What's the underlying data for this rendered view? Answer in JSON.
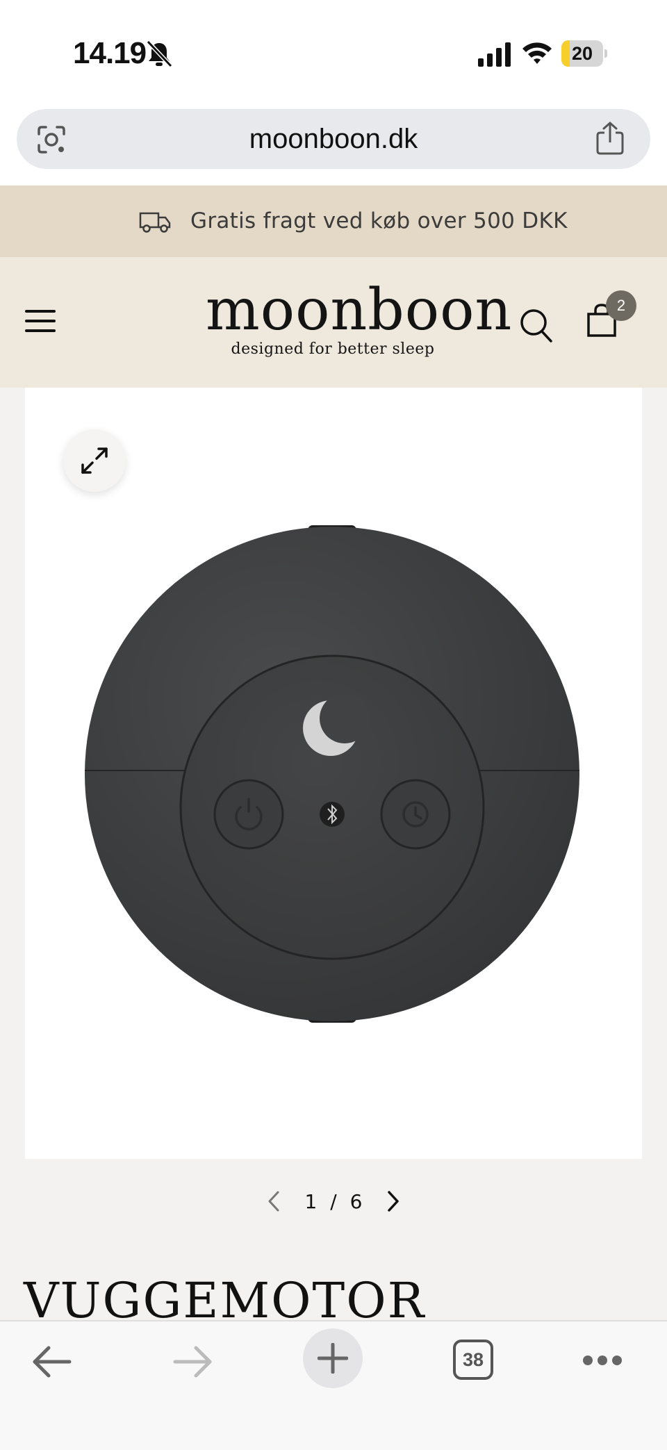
{
  "status_bar": {
    "time": "14.19",
    "battery": "20",
    "battery_level": 0.2
  },
  "browser": {
    "url": "moonboon.dk",
    "tab_count": "38"
  },
  "promo": {
    "text": "Gratis fragt ved køb over 500 DKK"
  },
  "header": {
    "logo": "moonboon",
    "tagline": "designed for better sleep",
    "cart_count": "2"
  },
  "gallery": {
    "current": "1",
    "separator": "/",
    "total": "6"
  },
  "product": {
    "title": "VUGGEMOTOR"
  },
  "icons": {
    "status": [
      "bell-off-icon",
      "signal-icon",
      "wifi-icon",
      "battery-icon"
    ],
    "browser": [
      "lens-icon",
      "share-icon",
      "back-arrow-icon",
      "forward-arrow-icon",
      "plus-icon",
      "more-icon"
    ],
    "site": [
      "truck-icon",
      "menu-icon",
      "search-icon",
      "cart-icon",
      "expand-icon",
      "chevron-left-icon",
      "chevron-right-icon"
    ]
  },
  "colors": {
    "promo_bg": "#e4d8c6",
    "header_bg": "#efe8dd",
    "page_bg": "#f3f2f0",
    "device": "#3d3e3f",
    "battery": "#f7cf2b"
  }
}
